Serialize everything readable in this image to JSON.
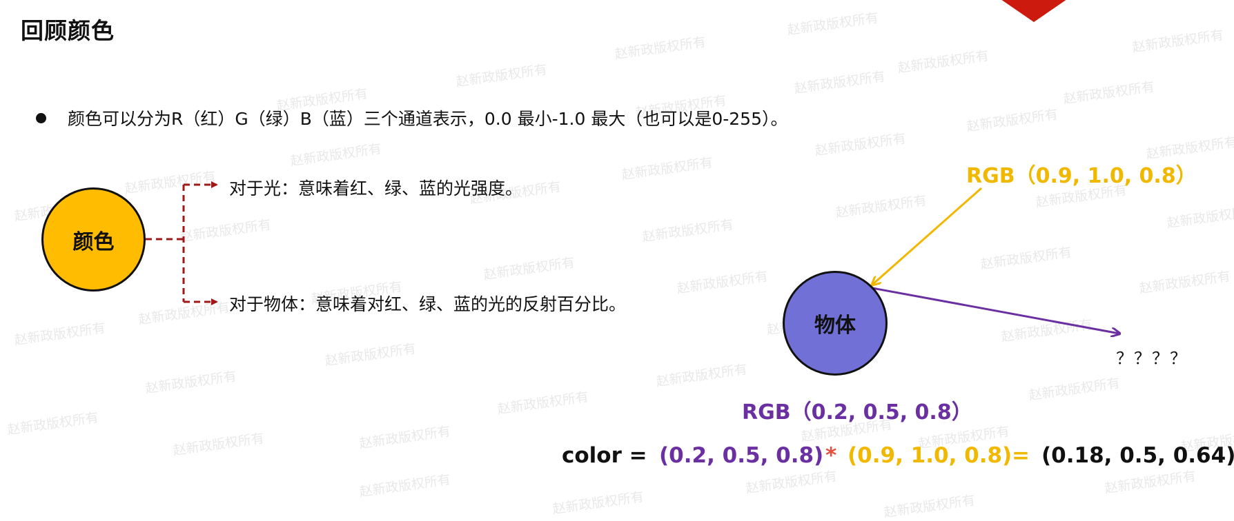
{
  "slide": {
    "title": "回顾颜色",
    "bullet": "颜色可以分为R（红）G（绿）B（蓝）三个通道表示，0.0 最小-1.0 最大（也可以是0-255）。"
  },
  "diagram": {
    "color_node": "颜色",
    "branch_light": "对于光：意味着红、绿、蓝的光强度。",
    "branch_object": "对于物体：意味着对红、绿、蓝的光的反射百分比。",
    "object_node": "物体",
    "light_rgb": "RGB（0.9, 1.0, 0.8）",
    "object_rgb": "RGB（0.2, 0.5, 0.8）",
    "unknown": "？？？？"
  },
  "formula": {
    "label": "color =",
    "a": "(0.2, 0.5, 0.8)",
    "op": "*",
    "b": "(0.9, 1.0, 0.8)",
    "eq": "=",
    "result": "(0.18, 0.5, 0.64)"
  },
  "watermark": "赵新政版权所有",
  "colors": {
    "color_node": "#ffbc00",
    "object_node": "#7070d6",
    "light_rgb": "#f0b800",
    "object_rgb": "#6a2fa0",
    "connector": "#a01818",
    "corner_shape": "#cc1a0e"
  }
}
